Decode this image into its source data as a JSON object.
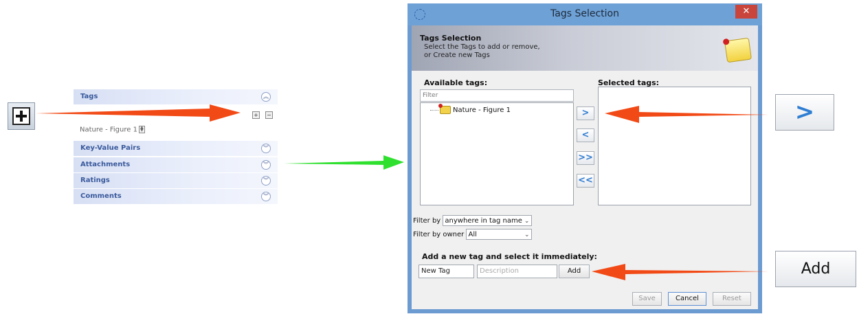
{
  "left_panel": {
    "sections": [
      {
        "label": "Tags",
        "state": "expanded"
      },
      {
        "label": "Key-Value Pairs",
        "state": "collapsed"
      },
      {
        "label": "Attachments",
        "state": "collapsed"
      },
      {
        "label": "Ratings",
        "state": "collapsed"
      },
      {
        "label": "Comments",
        "state": "collapsed"
      }
    ],
    "tag_entry": "Nature - Figure 1",
    "add_glyph": "+",
    "remove_glyph": "−"
  },
  "dialog": {
    "window_title": "Tags Selection",
    "close_glyph": "✕",
    "header_title": "Tags Selection",
    "header_line1": "Select the Tags to add or remove,",
    "header_line2": "or Create new Tags",
    "available_label": "Available tags:",
    "selected_label": "Selected tags:",
    "filter_placeholder": "Filter",
    "available_items": [
      "Nature - Figure 1"
    ],
    "move_buttons": [
      ">",
      "<",
      ">>",
      "<<"
    ],
    "filter_by_label": "Filter by",
    "filter_by_value": "anywhere in tag name",
    "filter_owner_label": "Filter by owner",
    "filter_owner_value": "All",
    "add_new_label": "Add a new tag and select it immediately:",
    "new_tag_value": "New Tag",
    "description_placeholder": "Description",
    "add_button": "Add",
    "save_button": "Save",
    "cancel_button": "Cancel",
    "reset_button": "Reset"
  },
  "callouts": {
    "arrow_glyph": ">",
    "add_label": "Add"
  },
  "colors": {
    "arrow_red": "#f24a16",
    "arrow_green": "#2fe02f",
    "titlebar": "#6ea1d6",
    "close_red": "#c9443b",
    "accent_blue": "#2e7bd1"
  }
}
